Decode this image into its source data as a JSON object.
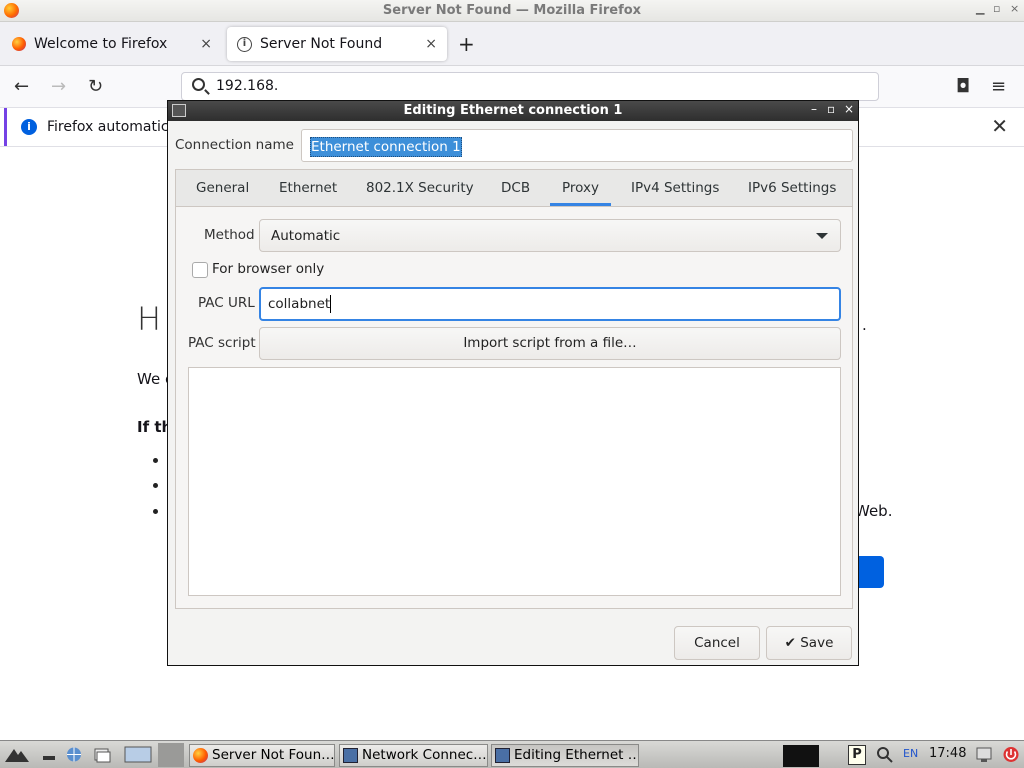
{
  "window": {
    "title": "Server Not Found — Mozilla Firefox"
  },
  "tabs": [
    {
      "label": "Welcome to Firefox",
      "close": "×"
    },
    {
      "label": "Server Not Found",
      "close": "×"
    }
  ],
  "new_tab": "+",
  "nav": {
    "back": "←",
    "forward": "→",
    "reload": "↻",
    "url": "192.168.",
    "pocket": "◘",
    "menu": "≡"
  },
  "notification": {
    "text": "Firefox automatica",
    "close": "✕"
  },
  "error_page": {
    "heading_fragment": "H",
    "para_fragment": "We c",
    "bold_fragment": "If th",
    "web_fragment": "Web.",
    "dot_fragment": "."
  },
  "dialog": {
    "title": "Editing Ethernet connection 1",
    "controls": {
      "minimize": "–",
      "maximize": "▫",
      "close": "×"
    },
    "connection_name_label": "Connection name",
    "connection_name_value": "Ethernet connection 1",
    "tabs": [
      "General",
      "Ethernet",
      "802.1X Security",
      "DCB",
      "Proxy",
      "IPv4 Settings",
      "IPv6 Settings"
    ],
    "active_tab": "Proxy",
    "method_label": "Method",
    "method_value": "Automatic",
    "browser_only_label": "For browser only",
    "browser_only_checked": false,
    "pac_url_label": "PAC URL",
    "pac_url_value": "collabnet",
    "pac_script_label": "PAC script",
    "import_button": "Import script from a file…",
    "pac_script_text": "",
    "cancel_button": "Cancel",
    "save_button": "Save",
    "save_icon": "✔"
  },
  "taskbar": {
    "tasks": [
      {
        "label": "Server Not Foun…",
        "icon": "firefox-icon"
      },
      {
        "label": "Network Connec…",
        "icon": "network-icon"
      },
      {
        "label": "Editing Ethernet …",
        "icon": "network-icon"
      }
    ],
    "lang": "EN",
    "clock": "17:48"
  },
  "colors": {
    "accent": "#3584e4",
    "selection": "#3d8fd9",
    "dialog_title": "#2e2e2e",
    "notif_bar": "#7542e5"
  }
}
